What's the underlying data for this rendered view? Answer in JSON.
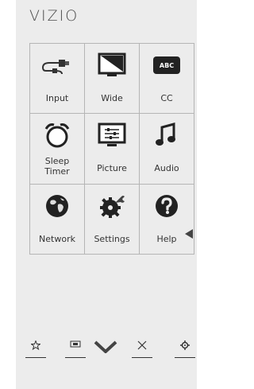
{
  "brand": {
    "logo_text": "VIZIO"
  },
  "menu": {
    "tiles": [
      {
        "label": "Input",
        "icon": "input-cable-icon"
      },
      {
        "label": "Wide",
        "icon": "wide-screen-icon"
      },
      {
        "label": "CC",
        "icon": "closed-caption-icon",
        "badge": "ABC"
      },
      {
        "label": "Sleep Timer",
        "icon": "alarm-clock-icon"
      },
      {
        "label": "Picture",
        "icon": "picture-settings-icon"
      },
      {
        "label": "Audio",
        "icon": "music-note-icon"
      },
      {
        "label": "Network",
        "icon": "globe-icon"
      },
      {
        "label": "Settings",
        "icon": "wrench-gear-icon"
      },
      {
        "label": "Help",
        "icon": "question-icon"
      }
    ]
  },
  "bottom_bar": {
    "items": [
      "star-icon",
      "screen-icon",
      "chevron-down-icon",
      "close-icon",
      "gear-icon"
    ]
  }
}
